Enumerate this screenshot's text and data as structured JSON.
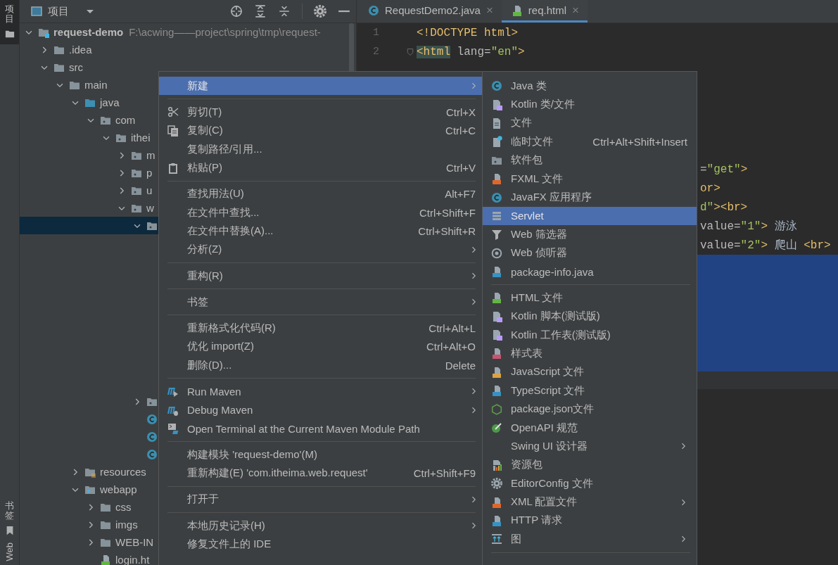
{
  "tool_strip": {
    "top_tabs": [
      {
        "label": "项目",
        "kind": "project",
        "selected": true
      }
    ],
    "bottom_tabs": [
      {
        "label": "书签",
        "kind": "bookmarks",
        "selected": false
      },
      {
        "label": "Web",
        "kind": "web",
        "selected": false
      }
    ]
  },
  "project_panel": {
    "title": "项目",
    "tree": [
      {
        "label": "request-demo",
        "path": "F:\\acwing——project\\spring\\tmp\\request-",
        "kind": "module",
        "expanded": true,
        "selected": false,
        "children": [
          {
            "label": ".idea",
            "kind": "folder",
            "expanded": false,
            "selected": false
          },
          {
            "label": "src",
            "kind": "folder",
            "expanded": true,
            "selected": false,
            "children": [
              {
                "label": "main",
                "kind": "folder",
                "expanded": true,
                "selected": false,
                "children": [
                  {
                    "label": "java",
                    "kind": "source-folder",
                    "expanded": true,
                    "selected": false,
                    "children": [
                      {
                        "label": "com",
                        "kind": "package",
                        "expanded": true,
                        "selected": false,
                        "children": [
                          {
                            "label": "ithei",
                            "kind": "package",
                            "expanded": true,
                            "selected": false,
                            "children": [
                              {
                                "label": "m",
                                "kind": "package",
                                "expanded": false,
                                "selected": false
                              },
                              {
                                "label": "p",
                                "kind": "package",
                                "expanded": false,
                                "selected": false
                              },
                              {
                                "label": "u",
                                "kind": "package",
                                "expanded": false,
                                "selected": false
                              },
                              {
                                "label": "w",
                                "kind": "package",
                                "expanded": true,
                                "selected": false,
                                "children": [
                                  {
                                    "kind": "package",
                                    "expanded": true,
                                    "selected": true
                                  },
                                  {
                                    "kind": "package",
                                    "expanded": false,
                                    "selected": false
                                  },
                                  {
                                    "kind": "class",
                                    "selected": false
                                  },
                                  {
                                    "kind": "class",
                                    "selected": false
                                  },
                                  {
                                    "kind": "class",
                                    "selected": false
                                  }
                                ]
                              }
                            ]
                          }
                        ]
                      }
                    ]
                  },
                  {
                    "label": "resources",
                    "kind": "resources",
                    "expanded": false,
                    "selected": false
                  },
                  {
                    "label": "webapp",
                    "kind": "webapp",
                    "expanded": true,
                    "selected": false,
                    "children": [
                      {
                        "label": "css",
                        "kind": "folder",
                        "expanded": false,
                        "selected": false
                      },
                      {
                        "label": "imgs",
                        "kind": "folder",
                        "expanded": false,
                        "selected": false
                      },
                      {
                        "label": "WEB-IN",
                        "kind": "folder",
                        "expanded": false,
                        "selected": false
                      },
                      {
                        "label": "login.ht",
                        "kind": "html",
                        "selected": false
                      }
                    ]
                  }
                ]
              }
            ]
          }
        ]
      }
    ]
  },
  "editor": {
    "tabs": [
      {
        "label": "RequestDemo2.java",
        "kind": "class",
        "close": "×",
        "selected": false
      },
      {
        "label": "req.html",
        "kind": "html",
        "close": "×",
        "selected": true
      }
    ],
    "lines": [
      {
        "number": "1",
        "fold": false,
        "tokens": [
          {
            "kind": "tag",
            "text": "<!DOCTYPE html>"
          }
        ]
      },
      {
        "number": "2",
        "fold": true,
        "tokens": [
          {
            "kind": "tag-match",
            "text": "<html"
          },
          {
            "kind": "attr",
            "text": " lang="
          },
          {
            "kind": "string",
            "text": "\"en\""
          },
          {
            "kind": "tag",
            "text": ">"
          }
        ]
      }
    ],
    "code_fragments": [
      [
        {
          "kind": "attr",
          "text": "="
        },
        {
          "kind": "string",
          "text": "\"get\""
        },
        {
          "kind": "tag",
          "text": ">"
        }
      ],
      [
        {
          "kind": "tag",
          "text": "or>"
        }
      ],
      [
        {
          "kind": "string",
          "text": "d\""
        },
        {
          "kind": "tag",
          "text": "><br>"
        }
      ],
      [
        {
          "kind": "attr",
          "text": "value="
        },
        {
          "kind": "string",
          "text": "\"1\""
        },
        {
          "kind": "tag",
          "text": ">"
        },
        {
          "kind": "text",
          "text": " 游泳"
        }
      ],
      [
        {
          "kind": "attr",
          "text": "value="
        },
        {
          "kind": "string",
          "text": "\"2\""
        },
        {
          "kind": "tag",
          "text": ">"
        },
        {
          "kind": "text",
          "text": " 爬山 "
        },
        {
          "kind": "tag",
          "text": "<br>"
        }
      ]
    ]
  },
  "context_menu": {
    "items": [
      {
        "kind": "plain",
        "label": "新建",
        "selected": true,
        "submenu": true
      },
      {
        "kind": "separator"
      },
      {
        "kind": "scissors",
        "label": "剪切(T)",
        "shortcut": "Ctrl+X",
        "selected": false,
        "submenu": false
      },
      {
        "kind": "copy",
        "label": "复制(C)",
        "shortcut": "Ctrl+C",
        "selected": false,
        "submenu": false
      },
      {
        "kind": "plain",
        "label": "复制路径/引用...",
        "selected": false,
        "submenu": false
      },
      {
        "kind": "paste",
        "label": "粘贴(P)",
        "shortcut": "Ctrl+V",
        "selected": false,
        "submenu": false
      },
      {
        "kind": "separator"
      },
      {
        "kind": "plain",
        "label": "查找用法(U)",
        "shortcut": "Alt+F7",
        "selected": false,
        "submenu": false
      },
      {
        "kind": "plain",
        "label": "在文件中查找...",
        "shortcut": "Ctrl+Shift+F",
        "selected": false,
        "submenu": false
      },
      {
        "kind": "plain",
        "label": "在文件中替换(A)...",
        "shortcut": "Ctrl+Shift+R",
        "selected": false,
        "submenu": false
      },
      {
        "kind": "plain",
        "label": "分析(Z)",
        "selected": false,
        "submenu": true
      },
      {
        "kind": "separator"
      },
      {
        "kind": "plain",
        "label": "重构(R)",
        "selected": false,
        "submenu": true
      },
      {
        "kind": "separator"
      },
      {
        "kind": "plain",
        "label": "书签",
        "selected": false,
        "submenu": true
      },
      {
        "kind": "separator"
      },
      {
        "kind": "plain",
        "label": "重新格式化代码(R)",
        "shortcut": "Ctrl+Alt+L",
        "selected": false,
        "submenu": false
      },
      {
        "kind": "plain",
        "label": "优化 import(Z)",
        "shortcut": "Ctrl+Alt+O",
        "selected": false,
        "submenu": false
      },
      {
        "kind": "plain",
        "label": "删除(D)...",
        "shortcut": "Delete",
        "selected": false,
        "submenu": false
      },
      {
        "kind": "separator"
      },
      {
        "kind": "run",
        "label": "Run Maven",
        "selected": false,
        "submenu": true
      },
      {
        "kind": "debug",
        "label": "Debug Maven",
        "selected": false,
        "submenu": true
      },
      {
        "kind": "terminal",
        "label": "Open Terminal at the Current Maven Module Path",
        "selected": false,
        "submenu": false
      },
      {
        "kind": "separator"
      },
      {
        "kind": "plain",
        "label": "构建模块 'request-demo'(M)",
        "selected": false,
        "submenu": false
      },
      {
        "kind": "plain",
        "label": "重新构建(E) 'com.itheima.web.request'",
        "shortcut": "Ctrl+Shift+F9",
        "selected": false,
        "submenu": false
      },
      {
        "kind": "separator"
      },
      {
        "kind": "plain",
        "label": "打开于",
        "selected": false,
        "submenu": true
      },
      {
        "kind": "separator"
      },
      {
        "kind": "plain",
        "label": "本地历史记录(H)",
        "selected": false,
        "submenu": true
      },
      {
        "kind": "plain",
        "label": "修复文件上的 IDE",
        "selected": false,
        "submenu": false
      }
    ]
  },
  "submenu": {
    "items": [
      {
        "kind": "class",
        "label": "Java 类",
        "selected": false,
        "submenu": false
      },
      {
        "kind": "kotlin",
        "label": "Kotlin 类/文件",
        "selected": false,
        "submenu": false
      },
      {
        "kind": "file",
        "label": "文件",
        "selected": false,
        "submenu": false
      },
      {
        "kind": "scratch",
        "label": "临时文件",
        "shortcut": "Ctrl+Alt+Shift+Insert",
        "selected": false,
        "submenu": false
      },
      {
        "kind": "package",
        "label": "软件包",
        "selected": false,
        "submenu": false
      },
      {
        "kind": "xml",
        "label": "FXML 文件",
        "selected": false,
        "submenu": false
      },
      {
        "kind": "class",
        "label": "JavaFX 应用程序",
        "selected": false,
        "submenu": false
      },
      {
        "kind": "servlet",
        "label": "Servlet",
        "selected": true,
        "submenu": false
      },
      {
        "kind": "filter",
        "label": "Web 筛选器",
        "selected": false,
        "submenu": false
      },
      {
        "kind": "listener",
        "label": "Web 侦听器",
        "selected": false,
        "submenu": false
      },
      {
        "kind": "java",
        "label": "package-info.java",
        "selected": false,
        "submenu": false
      },
      {
        "kind": "separator"
      },
      {
        "kind": "html",
        "label": "HTML 文件",
        "selected": false,
        "submenu": false
      },
      {
        "kind": "kotlin",
        "label": "Kotlin 脚本(测试版)",
        "selected": false,
        "submenu": false
      },
      {
        "kind": "kotlin",
        "label": "Kotlin 工作表(测试版)",
        "selected": false,
        "submenu": false
      },
      {
        "kind": "css",
        "label": "样式表",
        "selected": false,
        "submenu": false
      },
      {
        "kind": "js",
        "label": "JavaScript 文件",
        "selected": false,
        "submenu": false
      },
      {
        "kind": "ts",
        "label": "TypeScript 文件",
        "selected": false,
        "submenu": false
      },
      {
        "kind": "hexagon",
        "label": "package.json文件",
        "selected": false,
        "submenu": false
      },
      {
        "kind": "gauge",
        "label": "OpenAPI 规范",
        "selected": false,
        "submenu": false
      },
      {
        "kind": "plain",
        "label": "Swing UI 设计器",
        "selected": false,
        "submenu": true
      },
      {
        "kind": "bundle",
        "label": "资源包",
        "selected": false,
        "submenu": false
      },
      {
        "kind": "gear",
        "label": "EditorConfig 文件",
        "selected": false,
        "submenu": false
      },
      {
        "kind": "xml",
        "label": "XML 配置文件",
        "selected": false,
        "submenu": true
      },
      {
        "kind": "api",
        "label": "HTTP 请求",
        "selected": false,
        "submenu": false
      },
      {
        "kind": "diagram",
        "label": "图",
        "selected": false,
        "submenu": true
      },
      {
        "kind": "separator"
      }
    ]
  }
}
